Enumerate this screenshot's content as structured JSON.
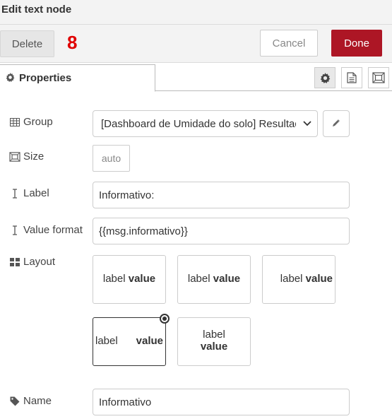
{
  "header": {
    "title": "Edit text node"
  },
  "actions": {
    "delete_label": "Delete",
    "badge": "8",
    "cancel_label": "Cancel",
    "done_label": "Done"
  },
  "tabs": {
    "properties_label": "Properties"
  },
  "form": {
    "group": {
      "label": "Group",
      "value": "[Dashboard de Umidade do solo] Resultado"
    },
    "size": {
      "label": "Size",
      "value": "auto"
    },
    "label": {
      "label": "Label",
      "value": "Informativo:"
    },
    "value_format": {
      "label": "Value format",
      "value": "{{msg.informativo}}"
    },
    "layout": {
      "label": "Layout",
      "options": [
        {
          "label": "label",
          "value": "value"
        },
        {
          "label": "label",
          "value": "value"
        },
        {
          "label": "label",
          "value": "value"
        },
        {
          "label": "label",
          "value": "value",
          "selected": true
        },
        {
          "label": "label",
          "value": "value"
        }
      ]
    },
    "name": {
      "label": "Name",
      "value": "Informativo"
    }
  },
  "colors": {
    "done": "#ad1625",
    "badge": "#e00000"
  }
}
